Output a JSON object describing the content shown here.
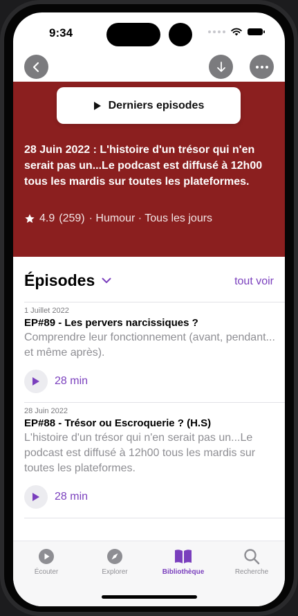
{
  "status_bar": {
    "time": "9:34"
  },
  "nav": {
    "back_icon": "chevron-left-icon",
    "download_icon": "arrow-down-circle-icon",
    "more_icon": "ellipsis-icon"
  },
  "hero": {
    "background": "#8b1f1f",
    "latest_button": "Derniers episodes",
    "description": "28 Juin 2022 : L'histoire d'un trésor qui n'en serait pas un...Le podcast est diffusé à 12h00 tous les mardis sur toutes les plateformes.",
    "rating": "4.9",
    "rating_count": "(259)",
    "meta": "· Humour · Tous les jours"
  },
  "episodes_section": {
    "title": "Épisodes",
    "see_all": "tout voir"
  },
  "episodes": [
    {
      "date": "1 Juillet 2022",
      "title": "EP#89 - Les pervers narcissiques ?",
      "summary": "Comprendre leur fonctionnement (avant, pendant... et même après).",
      "duration": "28 min"
    },
    {
      "date": "28 Juin 2022",
      "title": "EP#88 - Trésor ou Escroquerie ? (H.S)",
      "summary": "L'histoire d'un trésor qui n'en serait pas un...Le podcast est diffusé à 12h00 tous les mardis sur toutes les plateformes.",
      "duration": "28 min"
    }
  ],
  "tabbar": {
    "tabs": [
      {
        "label": "Écouter",
        "icon": "play-circle-icon"
      },
      {
        "label": "Explorer",
        "icon": "compass-icon"
      },
      {
        "label": "Bibliothèque",
        "icon": "book-icon",
        "active": true
      },
      {
        "label": "Recherche",
        "icon": "search-icon"
      }
    ]
  },
  "colors": {
    "accent": "#7a3fbd",
    "hero": "#8b1f1f"
  }
}
